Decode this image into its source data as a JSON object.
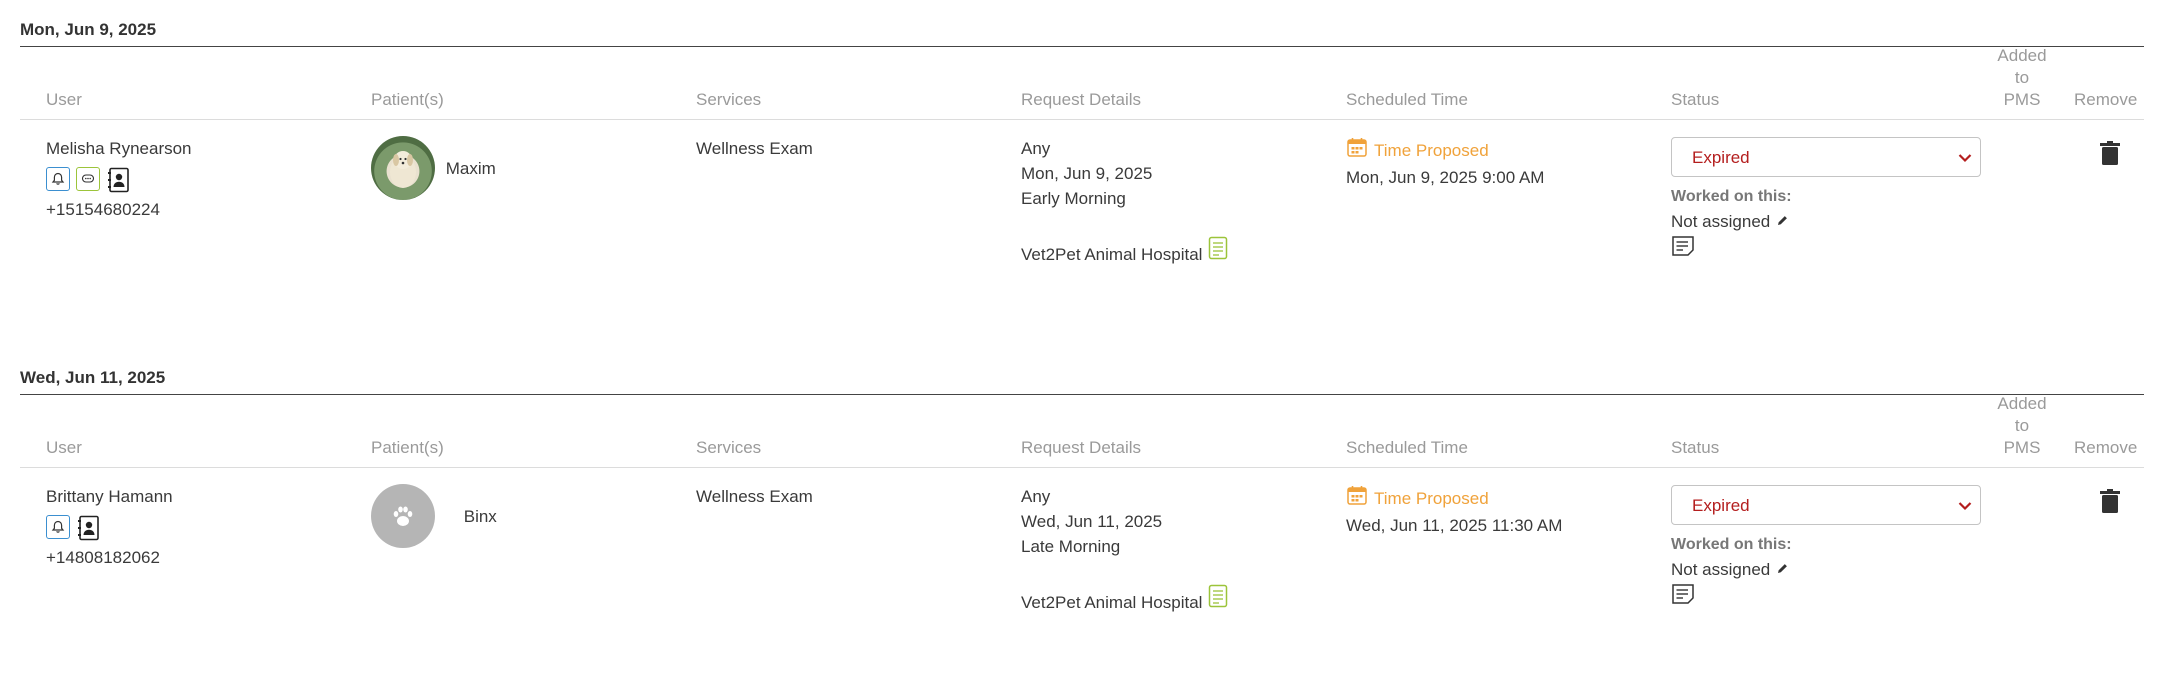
{
  "columns": {
    "user": "User",
    "patients": "Patient(s)",
    "services": "Services",
    "request_details": "Request Details",
    "scheduled_time": "Scheduled Time",
    "status": "Status",
    "added_to_pms_line1": "Added",
    "added_to_pms_line2": "to PMS",
    "remove": "Remove"
  },
  "days": [
    {
      "date": "Mon, Jun 9, 2025",
      "request": {
        "user_name": "Melisha Rynearson",
        "phone": "+15154680224",
        "contact_icons": [
          "bell-icon",
          "chat-icon",
          "contact-card-icon"
        ],
        "patient_name": "Maxim",
        "patient_avatar": "dog-photo",
        "service": "Wellness Exam",
        "detail_doctor": "Any",
        "detail_date": "Mon, Jun 9, 2025",
        "detail_time": "Early Morning",
        "detail_location": "Vet2Pet Animal Hospital",
        "schedule_status": "Time Proposed",
        "scheduled_time": "Mon, Jun 9, 2025 9:00 AM",
        "status_value": "Expired",
        "worked_label": "Worked on this:",
        "assigned": "Not assigned"
      }
    },
    {
      "date": "Wed, Jun 11, 2025",
      "request": {
        "user_name": "Brittany Hamann",
        "phone": "+14808182062",
        "contact_icons": [
          "bell-icon",
          "contact-card-icon"
        ],
        "patient_name": "Binx",
        "patient_avatar": "paw-placeholder",
        "service": "Wellness Exam",
        "detail_doctor": "Any",
        "detail_date": "Wed, Jun 11, 2025",
        "detail_time": "Late Morning",
        "detail_location": "Vet2Pet Animal Hospital",
        "schedule_status": "Time Proposed",
        "scheduled_time": "Wed, Jun 11, 2025 11:30 AM",
        "status_value": "Expired",
        "worked_label": "Worked on this:",
        "assigned": "Not assigned"
      }
    }
  ],
  "colors": {
    "accent_orange": "#f0a23a",
    "status_red": "#b41e1e",
    "bell_blue": "#3b8fd0",
    "chat_green": "#9cc43a"
  }
}
